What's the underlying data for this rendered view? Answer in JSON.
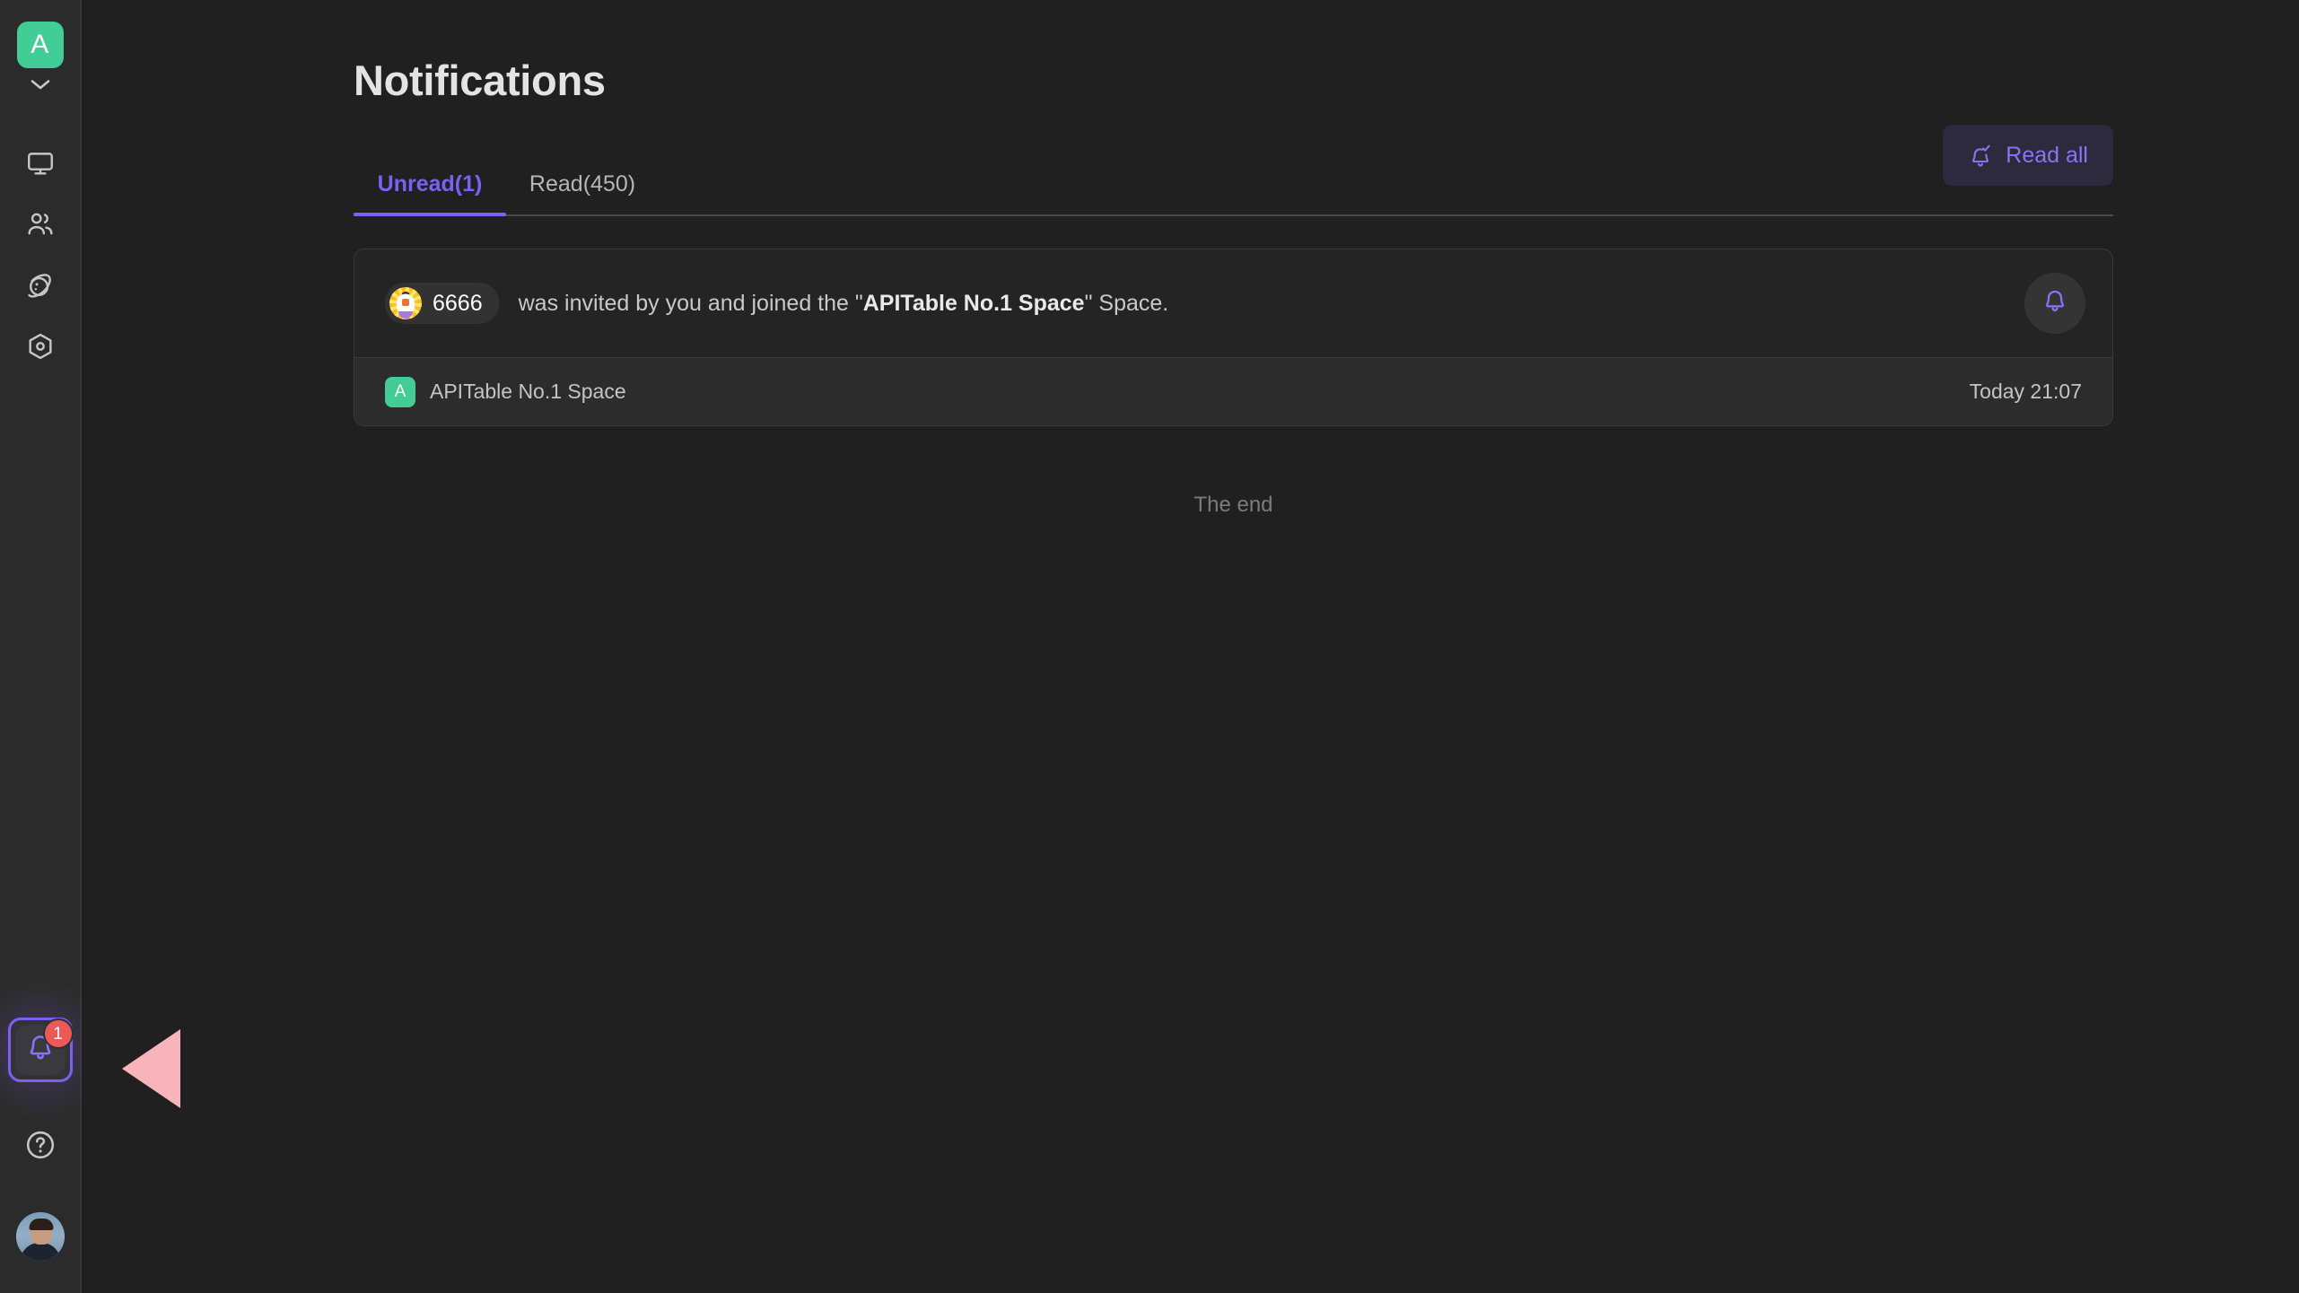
{
  "sidebar": {
    "logo": {
      "label": "A",
      "name": "space-logo"
    },
    "chevron_icon": "chevron-down-icon",
    "nav_items": [
      {
        "icon": "workbench-monitor-icon",
        "name": "sidebar-item-workbench"
      },
      {
        "icon": "members-people-icon",
        "name": "sidebar-item-members"
      },
      {
        "icon": "planet-space-icon",
        "name": "sidebar-item-space"
      },
      {
        "icon": "hexagon-template-icon",
        "name": "sidebar-item-template"
      }
    ],
    "notification": {
      "icon": "bell-icon",
      "badge_count": "1",
      "highlight_color": "#7b61f0",
      "badge_color": "#ec5959"
    },
    "help_icon": "question-circle-help-icon",
    "user_avatar": "user-avatar-photo"
  },
  "header": {
    "title": "Notifications"
  },
  "tabs": [
    {
      "label": "Unread(1)",
      "active": true,
      "name": "tab-unread"
    },
    {
      "label": "Read(450)",
      "active": false,
      "name": "tab-read"
    }
  ],
  "toolbar": {
    "read_all_label": "Read all",
    "read_all_icon": "bell-check-icon"
  },
  "notifications": [
    {
      "user": "6666",
      "avatar_icon": "chicken-avatar-icon",
      "message_prefix": "was invited by you and joined the \"",
      "message_bold": "APITable No.1 Space",
      "message_suffix": "\" Space.",
      "action_icon": "bell-icon",
      "space_badge": "A",
      "space_name": "APITable No.1 Space",
      "timestamp": "Today 21:07"
    }
  ],
  "footer": {
    "end_label": "The end"
  },
  "colors": {
    "accent_purple": "#7b61f0",
    "brand_green": "#41cd95",
    "badge_red": "#ec5959",
    "pointer_pink": "#f7b4bb"
  }
}
